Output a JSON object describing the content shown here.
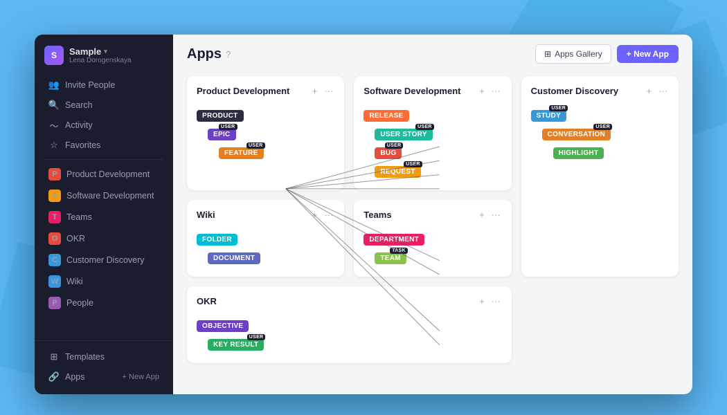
{
  "workspace": {
    "name": "Sample",
    "user": "Lena Dorogenskaya"
  },
  "sidebar": {
    "items": [
      {
        "id": "invite-people",
        "label": "Invite People",
        "icon": "👥"
      },
      {
        "id": "search",
        "label": "Search",
        "icon": "🔍"
      },
      {
        "id": "activity",
        "label": "Activity",
        "icon": "📈"
      },
      {
        "id": "favorites",
        "label": "Favorites",
        "icon": "⭐"
      }
    ],
    "spaces": [
      {
        "id": "product-development",
        "label": "Product Development",
        "color": "#e74c3c"
      },
      {
        "id": "software-development",
        "label": "Software Development",
        "color": "#f39c12"
      },
      {
        "id": "teams",
        "label": "Teams",
        "color": "#e91e63"
      },
      {
        "id": "okr",
        "label": "OKR",
        "color": "#e74c3c"
      },
      {
        "id": "customer-discovery",
        "label": "Customer Discovery",
        "color": "#3498db"
      },
      {
        "id": "wiki",
        "label": "Wiki",
        "color": "#3498db"
      },
      {
        "id": "people",
        "label": "People",
        "color": "#9b59b6"
      }
    ],
    "bottom": [
      {
        "id": "templates",
        "label": "Templates",
        "icon": "⊞"
      },
      {
        "id": "apps",
        "label": "Apps",
        "icon": "🔗"
      }
    ],
    "new_app_label": "+ New App"
  },
  "header": {
    "title": "Apps",
    "help_icon": "?",
    "gallery_btn": "Apps Gallery",
    "new_app_btn": "+ New App"
  },
  "cards": {
    "product_development": {
      "title": "Product Development",
      "nodes": [
        {
          "label": "PRODUCT",
          "color": "dark",
          "indent": 0
        },
        {
          "label": "EPIC",
          "color": "purple",
          "indent": 1,
          "badge": "USER"
        },
        {
          "label": "FEATURE",
          "color": "orange",
          "indent": 2,
          "badge": "USER"
        }
      ]
    },
    "software_development": {
      "title": "Software Development",
      "nodes": [
        {
          "label": "RELEASE",
          "color": "release",
          "indent": 0
        },
        {
          "label": "USER STORY",
          "color": "teal",
          "indent": 1,
          "badge": "USER"
        },
        {
          "label": "BUG",
          "color": "red",
          "indent": 1,
          "badge": "USER"
        },
        {
          "label": "REQUEST",
          "color": "amber",
          "indent": 1,
          "badge": "USER"
        }
      ]
    },
    "wiki": {
      "title": "Wiki",
      "nodes": [
        {
          "label": "FOLDER",
          "color": "cyan",
          "indent": 0
        },
        {
          "label": "DOCUMENT",
          "color": "indigo",
          "indent": 1
        }
      ]
    },
    "teams": {
      "title": "Teams",
      "nodes": [
        {
          "label": "DEPARTMENT",
          "color": "pink",
          "indent": 0
        },
        {
          "label": "TEAM",
          "color": "lime",
          "indent": 1,
          "badge": "TASK"
        }
      ]
    },
    "customer_discovery": {
      "title": "Customer Discovery",
      "nodes": [
        {
          "label": "STUDY",
          "color": "blue",
          "indent": 0,
          "badge": "USER"
        },
        {
          "label": "CONVERSATION",
          "color": "orange",
          "indent": 1,
          "badge": "USER"
        },
        {
          "label": "HIGHLIGHT",
          "color": "light-green",
          "indent": 2
        }
      ]
    },
    "okr": {
      "title": "OKR",
      "nodes": [
        {
          "label": "OBJECTIVE",
          "color": "purple",
          "indent": 0
        },
        {
          "label": "KEY RESULT",
          "color": "green",
          "indent": 1,
          "badge": "USER"
        }
      ]
    }
  }
}
